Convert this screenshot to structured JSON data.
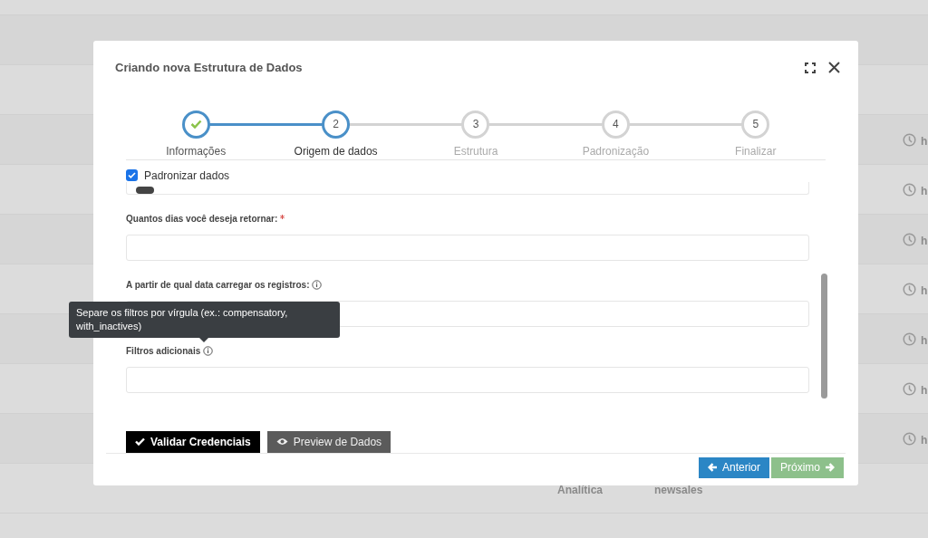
{
  "background_table": {
    "rows": [
      {},
      {},
      {
        "time": "h"
      },
      {
        "time": "h"
      },
      {
        "time": "h"
      },
      {
        "time": "h"
      },
      {
        "time": "h"
      },
      {
        "time": "h"
      },
      {
        "time": "h"
      },
      {
        "tipo": "Analítica",
        "origem": "newsales"
      }
    ]
  },
  "modal": {
    "title": "Criando nova Estrutura de Dados",
    "steps": [
      {
        "label": "Informações",
        "completed": true,
        "active": false
      },
      {
        "label": "Origem de dados",
        "number": "2",
        "completed": false,
        "active": true
      },
      {
        "label": "Estrutura",
        "number": "3",
        "completed": false,
        "active": false
      },
      {
        "label": "Padronização",
        "number": "4",
        "completed": false,
        "active": false
      },
      {
        "label": "Finalizar",
        "number": "5",
        "completed": false,
        "active": false
      }
    ],
    "standardize_checkbox": {
      "label": "Padronizar dados",
      "checked": true
    },
    "fields": [
      {
        "label": "Quantos dias você deseja retornar:",
        "required": true,
        "info": false
      },
      {
        "label": "A partir de qual data carregar os registros:",
        "required": false,
        "info": true
      },
      {
        "label": "Filtros adicionais",
        "required": false,
        "info": true
      }
    ],
    "tooltip": "Separe os filtros por vírgula (ex.: compensatory, with_inactives)",
    "action_buttons": [
      {
        "kind": "validate",
        "label": "Validar Credenciais"
      },
      {
        "kind": "preview",
        "label": "Preview de Dados"
      }
    ],
    "nav_buttons": [
      {
        "kind": "back",
        "label": "Anterior",
        "disabled": false
      },
      {
        "kind": "next",
        "label": "Próximo",
        "disabled": true
      }
    ]
  }
}
